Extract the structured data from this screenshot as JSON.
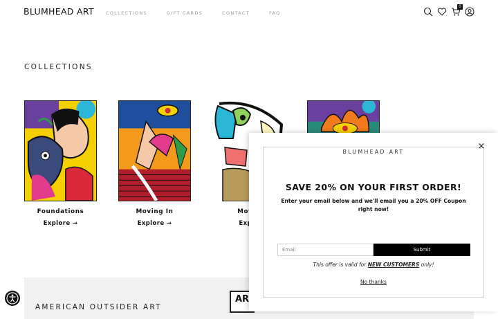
{
  "header": {
    "logo": "BLUMHEAD ART",
    "nav": [
      "COLLECTIONS",
      "GIFT CARDS",
      "CONTACT",
      "FAQ"
    ],
    "cart_count": "0",
    "icons": [
      "search-icon",
      "heart-icon",
      "cart-icon",
      "account-icon"
    ]
  },
  "main": {
    "section_title": "COLLECTIONS",
    "collections": [
      {
        "name": "Foundations",
        "explore": "Explore →"
      },
      {
        "name": "Moving In",
        "explore": "Explore →"
      },
      {
        "name": "Movin",
        "explore": "Explo"
      },
      {
        "name": "",
        "explore": ""
      }
    ]
  },
  "band": {
    "title": "AMERICAN OUTSIDER ART",
    "logo_text": "AR"
  },
  "popup": {
    "brand": "BLUMHEAD ART",
    "close": "×",
    "headline": "SAVE 20% ON YOUR FIRST ORDER!",
    "subtext": "Enter your email below and we'll email you a 20% OFF Coupon right now!",
    "email_placeholder": "Email",
    "submit_label": "Submit",
    "offer_prefix": "This offer is valid for ",
    "offer_emph": "NEW CUSTOMERS",
    "offer_suffix": " only!",
    "no_thanks": "No thanks"
  },
  "colors": {
    "accent": "#000000",
    "border": "#cfcfcf",
    "band_bg": "#f1f1f1"
  }
}
